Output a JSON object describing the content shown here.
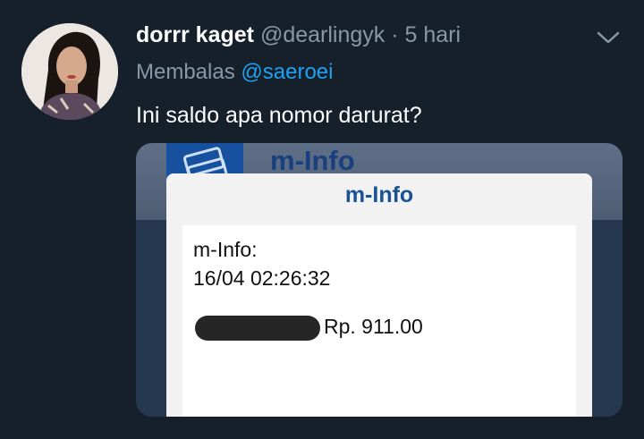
{
  "tweet": {
    "display_name": "dorrr kaget",
    "handle": "@dearlingyk",
    "separator": "·",
    "time": "5 hari",
    "reply_prefix": "Membalas",
    "reply_to": "@saeroei",
    "text": "Ini saldo apa nomor darurat?",
    "menu_icon": "chevron-down-icon"
  },
  "media": {
    "background_title": "m-Info",
    "dialog": {
      "title": "m-Info",
      "line1": "m-Info:",
      "line2": "16/04 02:26:32",
      "amount": "Rp. 911.00"
    }
  },
  "colors": {
    "background": "#15202b",
    "primary_text": "#ffffff",
    "secondary_text": "#8899a6",
    "link": "#1da1f2",
    "dialog_title": "#1a5298"
  }
}
